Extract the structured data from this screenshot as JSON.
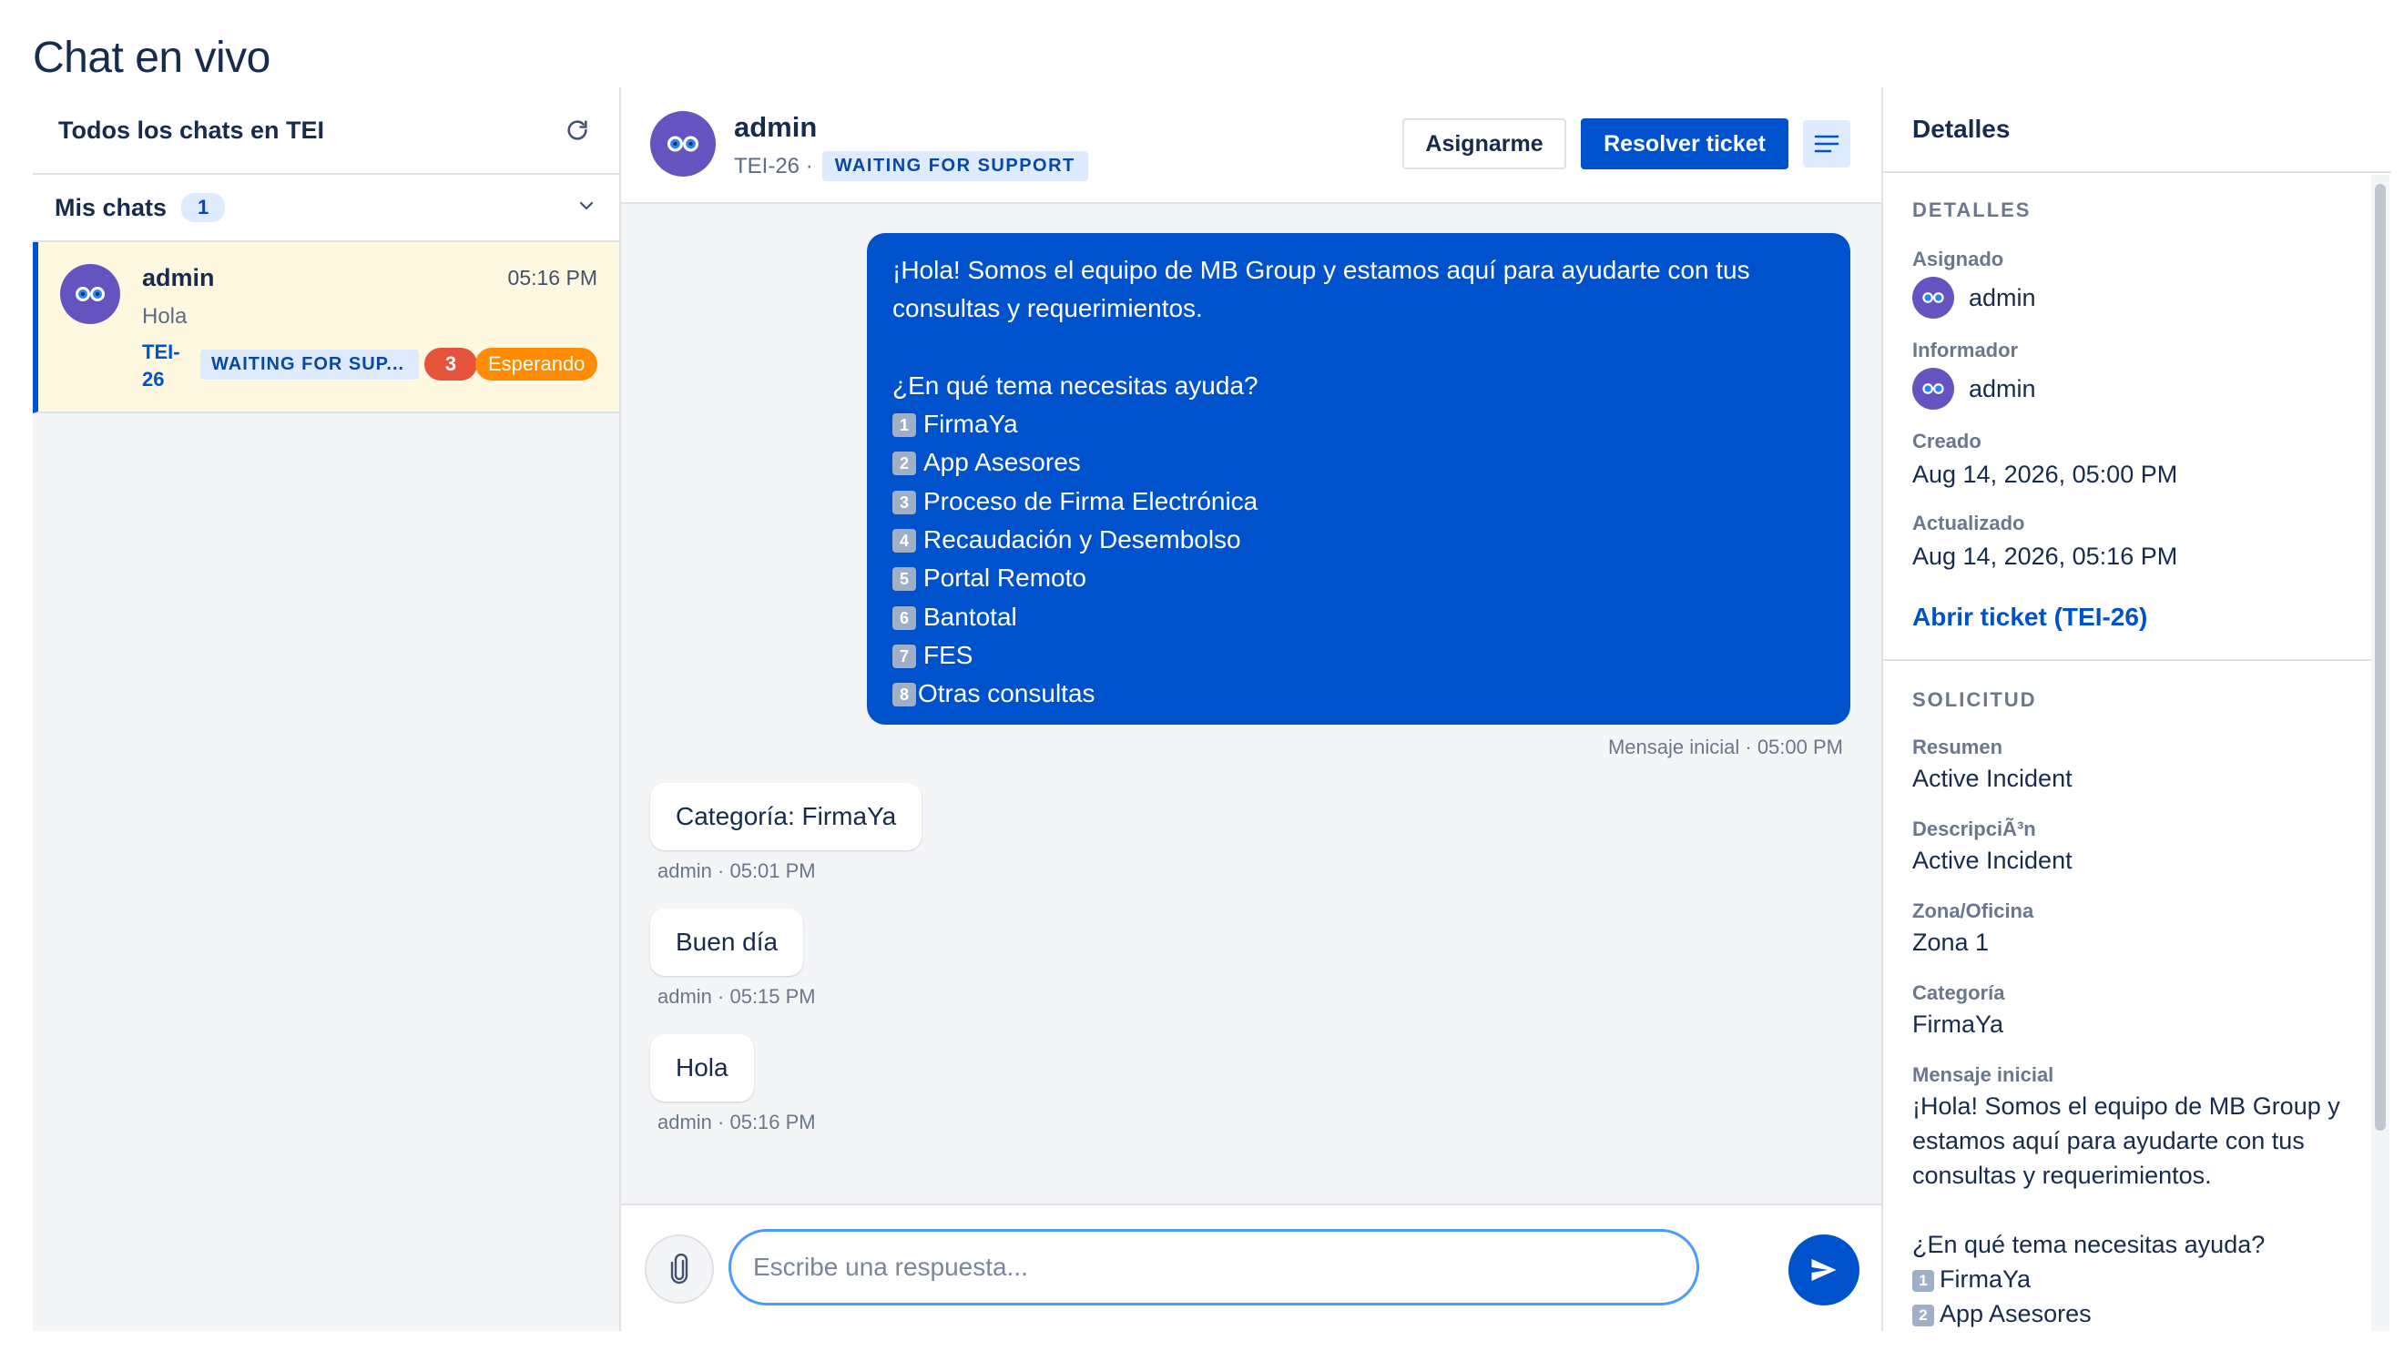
{
  "page": {
    "title": "Chat en vivo"
  },
  "sidebar": {
    "header_title": "Todos los chats en TEI",
    "group_label": "Mis chats",
    "group_count": "1",
    "chat": {
      "name": "admin",
      "time": "05:16 PM",
      "preview": "Hola",
      "key": "TEI-26",
      "status": "WAITING FOR SUP...",
      "unread": "3",
      "state": "Esperando"
    }
  },
  "conversation": {
    "name": "admin",
    "key": "TEI-26 ·",
    "status": "WAITING FOR SUPPORT",
    "assign_label": "Asignarme",
    "resolve_label": "Resolver ticket",
    "initial_message": {
      "line1": "¡Hola! Somos el equipo de MB Group y estamos aquí para ayudarte con tus",
      "line2": "consultas y requerimientos.",
      "question": "¿En qué tema necesitas ayuda?",
      "options": [
        {
          "num": "1",
          "text": "FirmaYa"
        },
        {
          "num": "2",
          "text": "App Asesores"
        },
        {
          "num": "3",
          "text": "Proceso de Firma Electrónica"
        },
        {
          "num": "4",
          "text": "Recaudación y Desembolso"
        },
        {
          "num": "5",
          "text": "Portal Remoto"
        },
        {
          "num": "6",
          "text": "Bantotal"
        },
        {
          "num": "7",
          "text": "FES"
        },
        {
          "num": "8",
          "text": "Otras consultas"
        }
      ],
      "meta": "Mensaje inicial · 05:00 PM"
    },
    "messages": [
      {
        "text": "Categoría: FirmaYa",
        "meta": "admin · 05:01 PM"
      },
      {
        "text": "Buen día",
        "meta": "admin · 05:15 PM"
      },
      {
        "text": "Hola",
        "meta": "admin · 05:16 PM"
      }
    ],
    "reply_placeholder": "Escribe una respuesta..."
  },
  "details": {
    "header": "Detalles",
    "section1": "DETALLES",
    "assigned_label": "Asignado",
    "assigned_value": "admin",
    "reporter_label": "Informador",
    "reporter_value": "admin",
    "created_label": "Creado",
    "created_value": "Aug 14, 2026, 05:00 PM",
    "updated_label": "Actualizado",
    "updated_value": "Aug 14, 2026, 05:16 PM",
    "open_link": "Abrir ticket (TEI-26)",
    "section2": "SOLICITUD",
    "summary_label": "Resumen",
    "summary_value": "Active Incident",
    "description_label": "DescripciÃ³n",
    "description_value": "Active Incident",
    "zone_label": "Zona/Oficina",
    "zone_value": "Zona 1",
    "category_label": "Categoría",
    "category_value": "FirmaYa",
    "initial_label": "Mensaje inicial",
    "initial_value": "¡Hola! Somos el equipo de MB Group y estamos aquí para ayudarte con tus consultas y requerimientos.",
    "initial_question": "¿En qué tema necesitas ayuda?",
    "initial_opt1_num": "1",
    "initial_opt1": "FirmaYa",
    "initial_opt2_num": "2",
    "initial_opt2": "App Asesores"
  },
  "colors": {
    "primary": "#0052cc",
    "accent_bg": "#deebff",
    "unread": "#e5533d",
    "waiting": "#ff8b00",
    "selected_row": "#fff8e1"
  }
}
